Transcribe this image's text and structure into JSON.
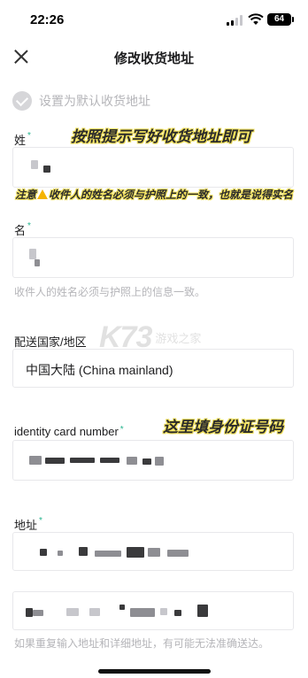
{
  "status_bar": {
    "time": "22:26",
    "battery": "64",
    "icons": [
      "signal-icon",
      "wifi-icon",
      "battery-icon"
    ]
  },
  "header": {
    "title": "修改收货地址",
    "close_icon": "close-icon"
  },
  "default_address": {
    "label": "设置为默认收货地址",
    "checked": false
  },
  "form": {
    "surname": {
      "label": "姓",
      "required_mark": "*"
    },
    "given_name": {
      "label": "名",
      "required_mark": "*",
      "hint": "收件人的姓名必须与护照上的信息一致。"
    },
    "country": {
      "label": "配送国家/地区",
      "value": "中国大陆 (China mainland)"
    },
    "id_number": {
      "label": "identity card number",
      "required_mark": "*"
    },
    "address": {
      "label": "地址",
      "required_mark": "*",
      "hint": "如果重复输入地址和详细地址，有可能无法准确送达。"
    }
  },
  "annotations": {
    "name_tip": "按照提示写好收货地址即可",
    "name_note_prefix": "注意",
    "name_note": "收件人的姓名必须与护照上的一致，也就是说得实名",
    "id_tip": "这里填身份证号码"
  },
  "watermark": {
    "logo": "K73",
    "text": "游戏之家"
  },
  "colors": {
    "accent": "#27b48e",
    "annotation_highlight": "#f2e15c",
    "hint_text": "#b5b5b9"
  }
}
